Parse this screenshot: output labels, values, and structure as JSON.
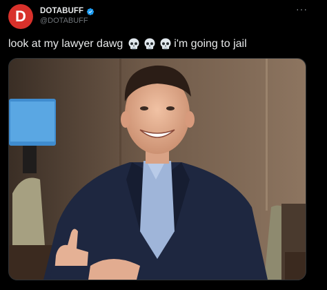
{
  "account": {
    "avatar_letter": "D",
    "display_name": "DOTABUFF",
    "handle": "@DOTABUFF",
    "verified": true
  },
  "more_menu_label": "···",
  "tweet": {
    "text_before": "look at my lawyer dawg",
    "emoji": [
      "skull",
      "skull",
      "skull"
    ],
    "text_after": "i'm going to jail"
  },
  "media": {
    "description_icon": "photo"
  },
  "colors": {
    "background": "#000000",
    "avatar": "#d8312b",
    "verified": "#1d9bf0",
    "text": "#e7e9ea",
    "muted": "#71767b"
  }
}
